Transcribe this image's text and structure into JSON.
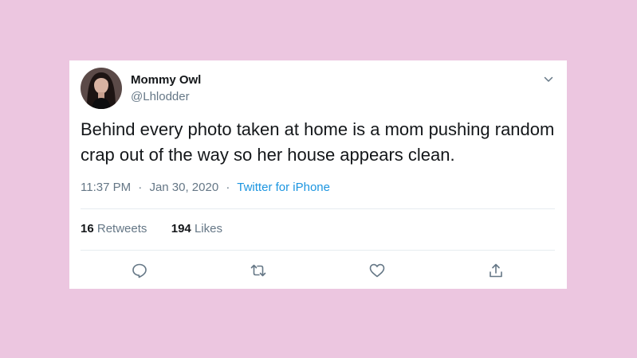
{
  "tweet": {
    "author": {
      "display_name": "Mommy Owl",
      "handle": "@Lhlodder"
    },
    "text": "Behind every photo taken at home is a mom pushing random crap out of the way so her house appears clean.",
    "time": "11:37 PM",
    "separator": "·",
    "date": "Jan 30, 2020",
    "source": "Twitter for iPhone",
    "retweets": {
      "count": "16",
      "label": "Retweets"
    },
    "likes": {
      "count": "194",
      "label": "Likes"
    }
  },
  "icons": {
    "menu": "chevron-down-icon",
    "reply": "reply-icon",
    "retweet": "retweet-icon",
    "like": "heart-icon",
    "share": "share-icon"
  },
  "colors": {
    "background": "#ecc6e0",
    "card": "#ffffff",
    "text": "#14171a",
    "secondary": "#657786",
    "link": "#1b95e0",
    "divider": "#e6ecf0"
  }
}
